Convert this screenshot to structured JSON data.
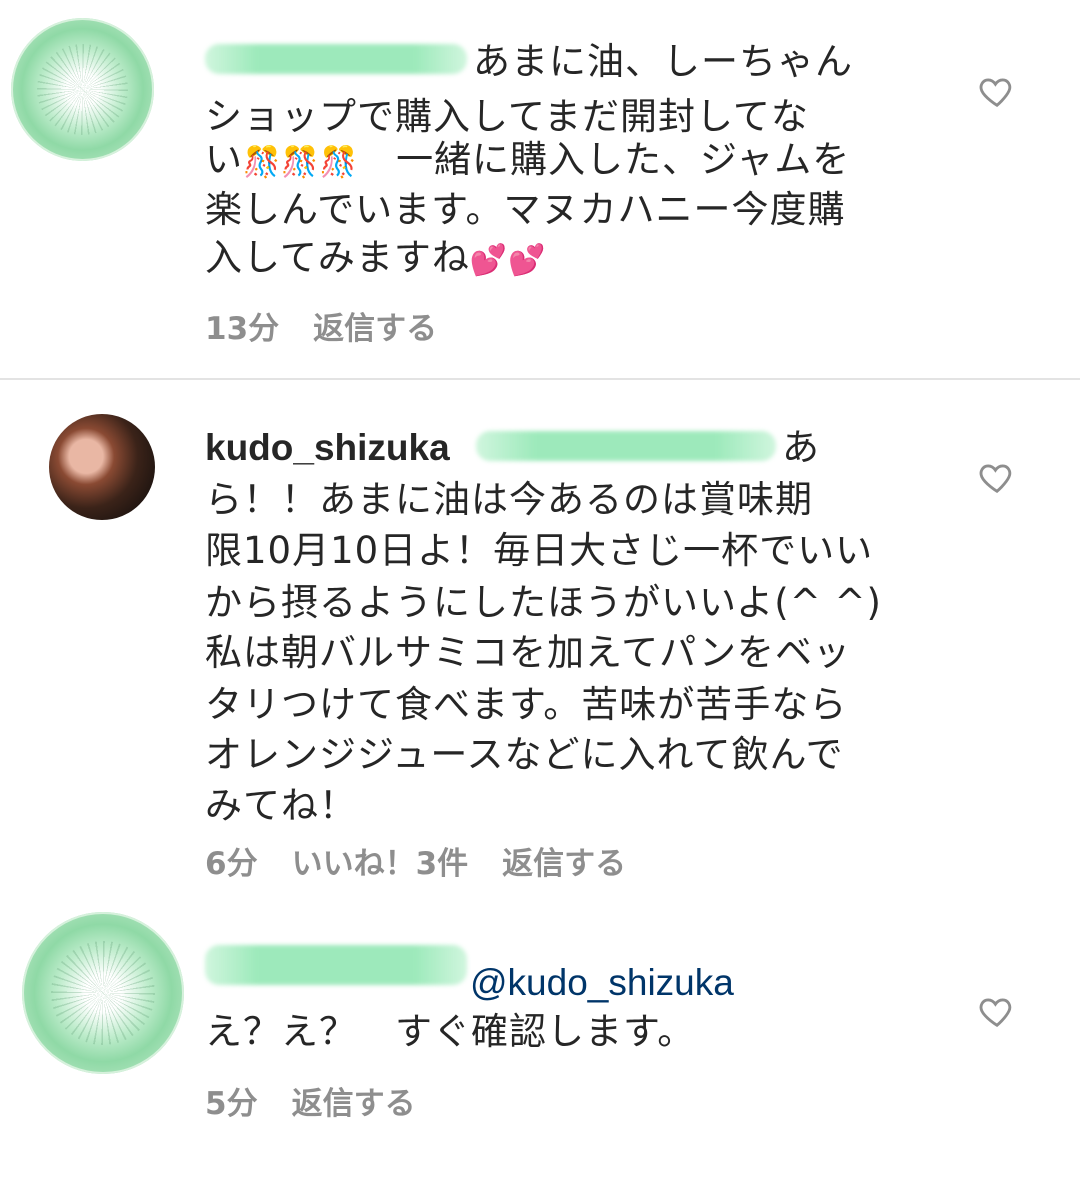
{
  "comments": [
    {
      "text_prefix": "あまに油、しーちゃん",
      "lines": [
        "ショップで購入してまだ開封してな",
        "楽しんでいます。マヌカハニー今度購"
      ],
      "line3_start": "い",
      "line3_end": "一緒に購入した、ジャムを",
      "line5": "入してみますね",
      "emoji_3": "🎊🎊🎊",
      "emoji_5": "💕💕",
      "time": "13分",
      "reply": "返信する"
    },
    {
      "username": "kudo_shizuka",
      "first_tail": "あ",
      "lines": [
        "ら！！あまに油は今あるのは賞味期",
        "限10月10日よ！毎日大さじ一杯でいい",
        "から摂るようにしたほうがいいよ(^ ^)",
        "私は朝バルサミコを加えてパンをベッ",
        "タリつけて食べます。苦味が苦手なら",
        "オレンジジュースなどに入れて飲んで",
        "みてね！"
      ],
      "time": "6分",
      "likes": "いいね！3件",
      "reply": "返信する"
    },
    {
      "mention": "@kudo_shizuka",
      "text": "え？え？　すぐ確認します。",
      "time": "5分",
      "reply": "返信する"
    }
  ],
  "icons": {
    "like": "heart-icon"
  }
}
